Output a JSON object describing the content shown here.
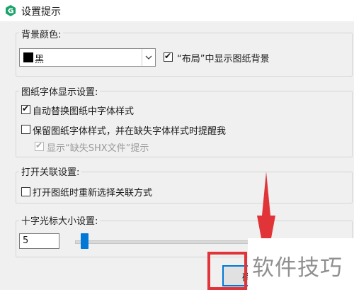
{
  "window": {
    "title": "设置提示"
  },
  "background_color": {
    "group_title": "背景颜色:",
    "selected_color": "黑",
    "swatch_color": "#000000",
    "show_bg_label": "“布局”中显示图纸背景",
    "show_bg_checked": true
  },
  "font_display": {
    "group_title": "图纸字体显示设置:",
    "auto_replace_label": "自动替换图纸中字体样式",
    "auto_replace_checked": true,
    "keep_style_label": "保留图纸字体样式，并在缺失字体样式时提醒我",
    "keep_style_checked": false,
    "show_missing_shx_label": "显示“缺失SHX文件”提示",
    "show_missing_shx_checked": true,
    "show_missing_shx_enabled": false
  },
  "open_assoc": {
    "group_title": "打开关联设置:",
    "reselect_label": "打开图纸时重新选择关联方式",
    "reselect_checked": false
  },
  "crosshair": {
    "group_title": "十字光标大小设置:",
    "size_value": "5",
    "slider_fraction": 0.05
  },
  "footer": {
    "ok_label_partial": "确"
  },
  "annotation": {
    "arrow_color": "#e13438",
    "highlight_color": "#e13438"
  },
  "watermark": {
    "text": "软件技巧"
  }
}
